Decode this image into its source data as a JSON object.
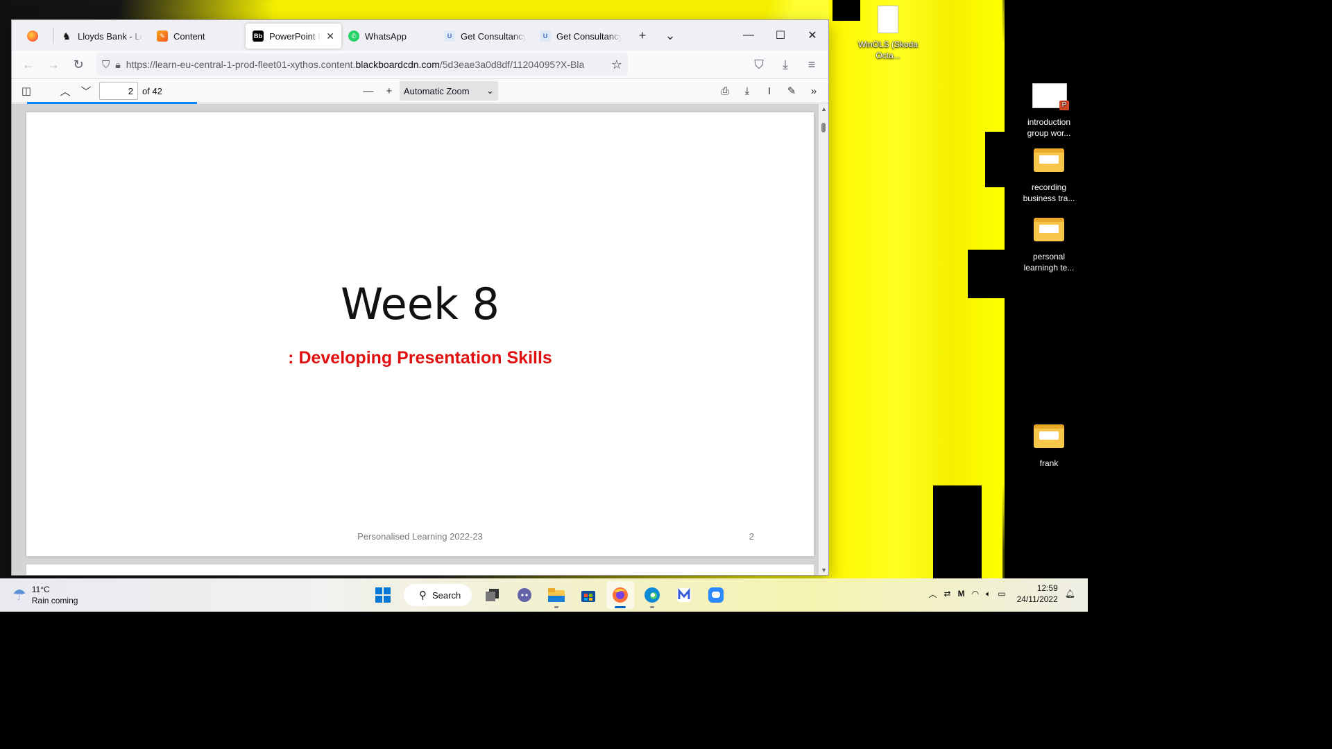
{
  "desktop": {
    "icons": [
      {
        "label": "WinOLS (Skoda Octa...",
        "type": "file"
      },
      {
        "label": "introduction group wor...",
        "type": "pptx"
      },
      {
        "label": "recording business tra...",
        "type": "folder"
      },
      {
        "label": "personal learningh te...",
        "type": "folder"
      },
      {
        "label": "frank",
        "type": "folder"
      }
    ]
  },
  "browser": {
    "tabs": [
      {
        "label": "Lloyds Bank - Log",
        "icon": "lloyds-horse-icon"
      },
      {
        "label": "Content",
        "icon": "blackboard-content-icon"
      },
      {
        "label": "PowerPoint Pre",
        "icon": "blackboard-bb-icon",
        "active": true
      },
      {
        "label": "WhatsApp",
        "icon": "whatsapp-icon"
      },
      {
        "label": "Get Consultancy I",
        "icon": "consultancy-icon"
      },
      {
        "label": "Get Consultancy I",
        "icon": "consultancy-icon"
      }
    ],
    "url_prefix": "https://learn-eu-central-1-prod-fleet01-xythos.content.",
    "url_domain": "blackboardcdn.com",
    "url_suffix": "/5d3eae3a0d8df/11204095?X-Bla"
  },
  "pdf": {
    "page_number": "2",
    "page_total": "of 42",
    "zoom": "Automatic Zoom"
  },
  "slide": {
    "title": "Week 8",
    "subtitle": ": Developing Presentation Skills",
    "footer": "Personalised Learning 2022-23",
    "number": "2"
  },
  "taskbar": {
    "weather_temp": "11°C",
    "weather_desc": "Rain coming",
    "search_label": "Search",
    "time": "12:59",
    "date": "24/11/2022"
  }
}
